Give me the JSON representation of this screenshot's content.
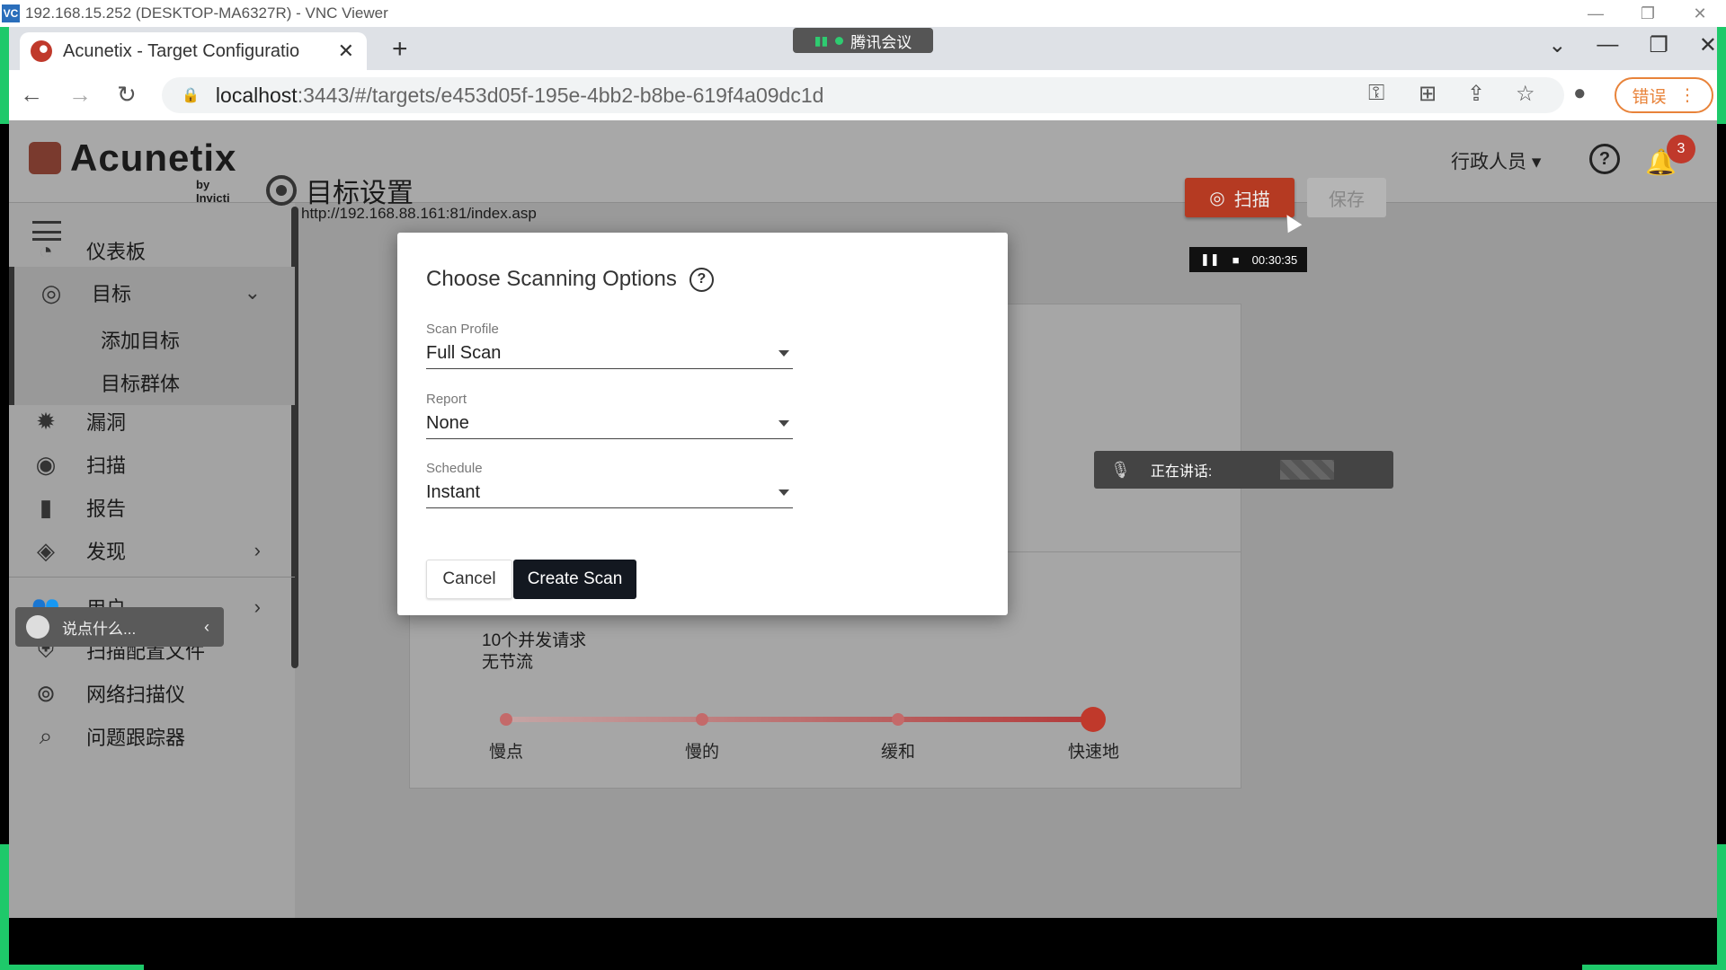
{
  "vnc": {
    "title": "192.168.15.252 (DESKTOP-MA6327R) - VNC Viewer",
    "logo": "VC"
  },
  "browser": {
    "tab_title": "Acunetix - Target Configuratio",
    "meeting_label": "腾讯会议",
    "url_host": "localhost",
    "url_path": ":3443/#/targets/e453d05f-195e-4bb2-b8be-619f4a09dc1d",
    "error_label": "错误"
  },
  "app": {
    "brand": "Acunetix",
    "brand_sub": "by Invicti",
    "user_label": "行政人员",
    "notification_count": "3"
  },
  "sidebar": {
    "items": [
      {
        "label": "仪表板"
      },
      {
        "label": "目标"
      },
      {
        "label": "漏洞"
      },
      {
        "label": "扫描"
      },
      {
        "label": "报告"
      },
      {
        "label": "发现"
      },
      {
        "label": "用户"
      },
      {
        "label": "扫描配置文件"
      },
      {
        "label": "网络扫描仪"
      },
      {
        "label": "问题跟踪器"
      }
    ],
    "sub_items": [
      {
        "label": "添加目标"
      },
      {
        "label": "目标群体"
      }
    ],
    "chat_hint": "说点什么..."
  },
  "main": {
    "title": "目标设置",
    "url": "http://192.168.88.161:81/index.asp",
    "scan_label": "扫描",
    "save_label": "保存",
    "bg_line1": "10个并发请求",
    "bg_line2": "无节流",
    "slider_labels": [
      "慢点",
      "慢的",
      "缓和",
      "快速地"
    ],
    "slider_value": "快速地"
  },
  "overlays": {
    "recorder_time": "00:30:35",
    "speaker_label": "正在讲话:"
  },
  "modal": {
    "title": "Choose Scanning Options",
    "scan_profile_label": "Scan Profile",
    "scan_profile_value": "Full Scan",
    "report_label": "Report",
    "report_value": "None",
    "schedule_label": "Schedule",
    "schedule_value": "Instant",
    "cancel_label": "Cancel",
    "create_label": "Create Scan"
  }
}
